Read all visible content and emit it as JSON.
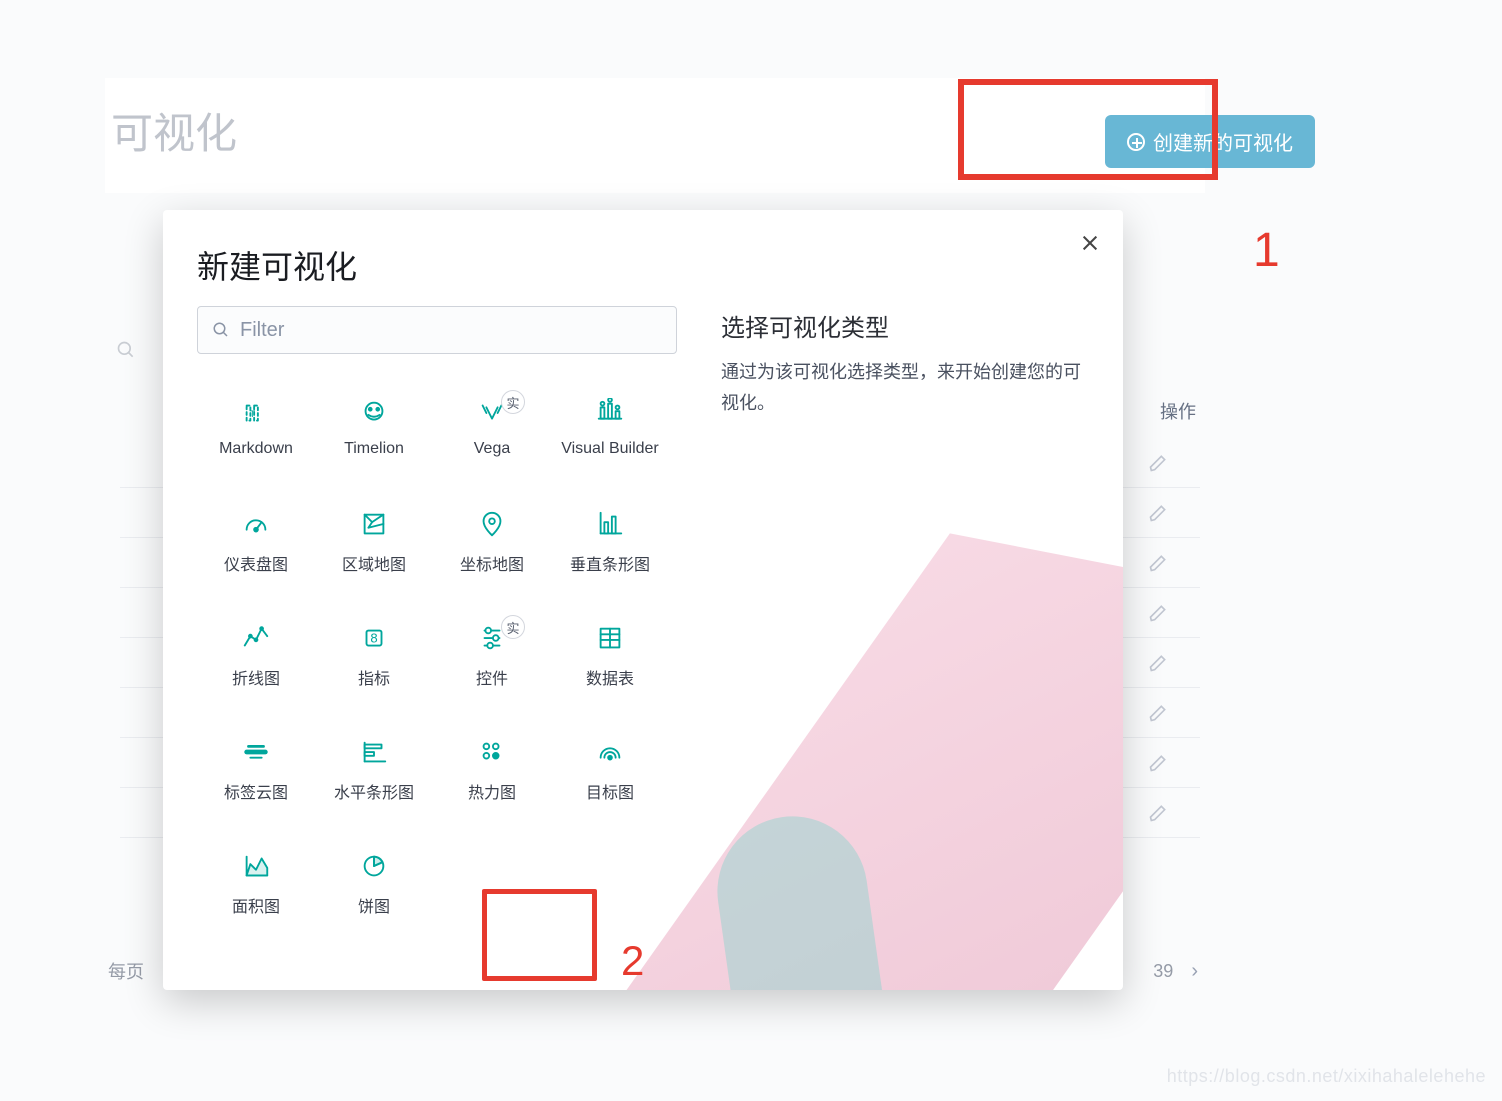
{
  "page": {
    "title": "可视化",
    "create_button": "创建新的可视化"
  },
  "annotations": {
    "label1": "1",
    "label2": "2"
  },
  "back_table": {
    "col_actions": "操作",
    "rows_count": 8
  },
  "pagination": {
    "per_page_label": "每页",
    "page_num": "39"
  },
  "modal": {
    "title": "新建可视化",
    "filter_placeholder": "Filter",
    "right_title": "选择可视化类型",
    "right_desc": "通过为该可视化选择类型，来开始创建您的可视化。",
    "experimental_badge": "实",
    "items": [
      {
        "label": "Markdown",
        "icon": "markdown"
      },
      {
        "label": "Timelion",
        "icon": "timelion"
      },
      {
        "label": "Vega",
        "icon": "vega",
        "badge": true
      },
      {
        "label": "Visual Builder",
        "icon": "visualbuilder"
      },
      {
        "label": "仪表盘图",
        "icon": "gauge"
      },
      {
        "label": "区域地图",
        "icon": "regionmap"
      },
      {
        "label": "坐标地图",
        "icon": "coordmap"
      },
      {
        "label": "垂直条形图",
        "icon": "vbar"
      },
      {
        "label": "折线图",
        "icon": "line"
      },
      {
        "label": "指标",
        "icon": "metric"
      },
      {
        "label": "控件",
        "icon": "controls",
        "badge": true
      },
      {
        "label": "数据表",
        "icon": "datatable"
      },
      {
        "label": "标签云图",
        "icon": "tagcloud"
      },
      {
        "label": "水平条形图",
        "icon": "hbar"
      },
      {
        "label": "热力图",
        "icon": "heatmap"
      },
      {
        "label": "目标图",
        "icon": "goal"
      },
      {
        "label": "面积图",
        "icon": "area"
      },
      {
        "label": "饼图",
        "icon": "pie"
      }
    ]
  },
  "watermark": "https://blog.csdn.net/xixihahalelehehe"
}
